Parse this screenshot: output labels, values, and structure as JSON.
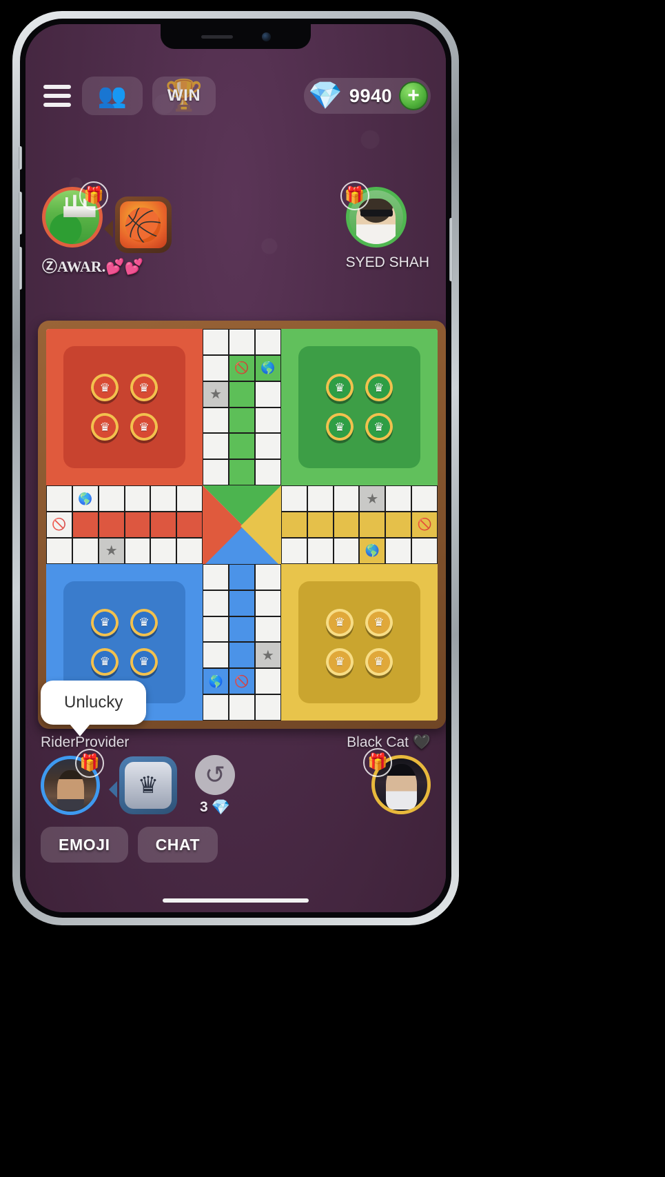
{
  "app": {
    "title": "Ludo Game",
    "background_color": "#4d2c49",
    "board_frame_color": "#8a5a31"
  },
  "top_bar": {
    "menu_icon": "hamburger-menu-icon",
    "friends_icon": "friends-icon",
    "win_label": "WIN",
    "trophy_icon": "trophy-icon",
    "gem_icon": "gem-icon",
    "coin_amount": "9940",
    "add_label": "+"
  },
  "players": {
    "top_left": {
      "name": "ⓏAWAR.💕💕",
      "color": "#e0603f",
      "gift_icon": "gift-icon",
      "emoji": "🏀",
      "emoji_name": "basketball-emoji"
    },
    "top_right": {
      "name": "SYED SHAH",
      "color": "#4fb750",
      "gift_icon": "gift-icon"
    },
    "bottom_left": {
      "name": "RiderProvider",
      "color": "#3e9af0",
      "gift_icon": "gift-icon",
      "emoji": "♛",
      "emoji_name": "crown-emoji"
    },
    "bottom_right": {
      "name": "Black Cat 🖤",
      "color": "#e8b93c",
      "gift_icon": "gift-icon"
    }
  },
  "chat_bubble": {
    "text": "Unlucky"
  },
  "dice": {
    "refresh_icon": "refresh-icon",
    "count": "3",
    "gem_icon": "gem-icon"
  },
  "action_buttons": {
    "emoji_label": "EMOJI",
    "chat_label": "CHAT"
  },
  "board": {
    "colors": {
      "red": "#e05a3d",
      "green": "#61c05c",
      "blue": "#4b93e8",
      "yellow": "#e8c44b"
    },
    "bases": [
      {
        "name": "red",
        "tokens": 4,
        "token_glyph": "♛"
      },
      {
        "name": "green",
        "tokens": 4,
        "token_glyph": "♛"
      },
      {
        "name": "blue",
        "tokens": 4,
        "token_glyph": "♛"
      },
      {
        "name": "yellow",
        "tokens": 4,
        "token_glyph": "♛"
      }
    ],
    "cell_icons": {
      "star": "★",
      "block": "🚫",
      "globe": "🌎"
    }
  }
}
